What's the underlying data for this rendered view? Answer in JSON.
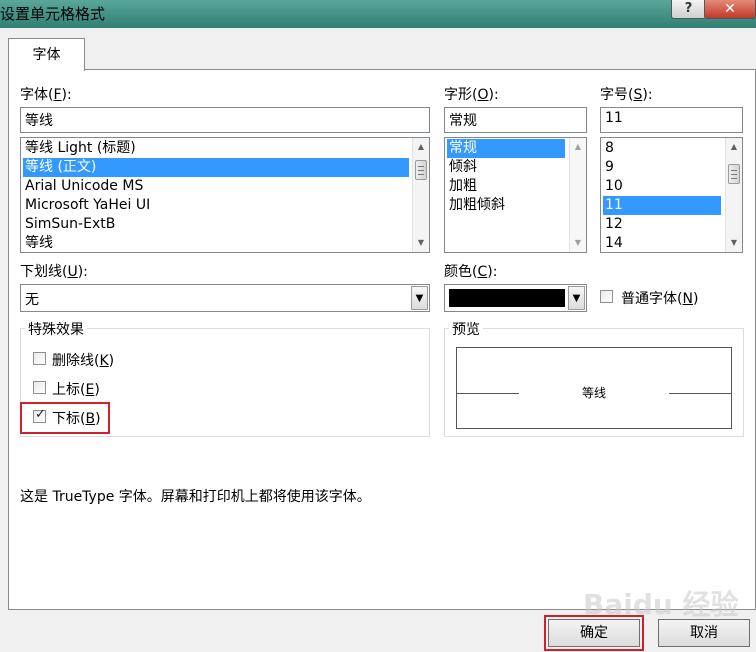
{
  "window": {
    "title": "设置单元格格式",
    "help": "?",
    "close": "✕"
  },
  "tab": {
    "label": "字体"
  },
  "font": {
    "label_pre": "字体(",
    "label_key": "F",
    "label_post": "):",
    "value": "等线",
    "items": [
      "等线 Light (标题)",
      "等线 (正文)",
      "Arial Unicode MS",
      "Microsoft YaHei UI",
      "SimSun-ExtB",
      "等线"
    ],
    "selected_index": 1
  },
  "style": {
    "label_pre": "字形(",
    "label_key": "O",
    "label_post": "):",
    "value": "常规",
    "items": [
      "常规",
      "倾斜",
      "加粗",
      "加粗倾斜"
    ],
    "selected_index": 0
  },
  "size": {
    "label_pre": "字号(",
    "label_key": "S",
    "label_post": "):",
    "value": "11",
    "items": [
      "8",
      "9",
      "10",
      "11",
      "12",
      "14"
    ],
    "selected_index": 3
  },
  "underline": {
    "label_pre": "下划线(",
    "label_key": "U",
    "label_post": "):",
    "value": "无"
  },
  "color": {
    "label_pre": "颜色(",
    "label_key": "C",
    "label_post": "):",
    "swatch": "#000000"
  },
  "normal_font": {
    "label_pre": "普通字体(",
    "label_key": "N",
    "label_post": ")",
    "checked": false
  },
  "effects": {
    "group_label": "特殊效果",
    "strike": {
      "label_pre": "删除线(",
      "label_key": "K",
      "label_post": ")",
      "checked": false
    },
    "superscript": {
      "label_pre": "上标(",
      "label_key": "E",
      "label_post": ")",
      "checked": false
    },
    "subscript": {
      "label_pre": "下标(",
      "label_key": "B",
      "label_post": ")",
      "checked": true
    }
  },
  "preview": {
    "group_label": "预览",
    "sample": "等线"
  },
  "info_text": "这是 TrueType 字体。屏幕和打印机上都将使用该字体。",
  "buttons": {
    "ok": "确定",
    "cancel": "取消"
  },
  "watermark": "Baidu 经验",
  "colors": {
    "selection": "#3399ff",
    "highlight_box": "#d0202a"
  }
}
